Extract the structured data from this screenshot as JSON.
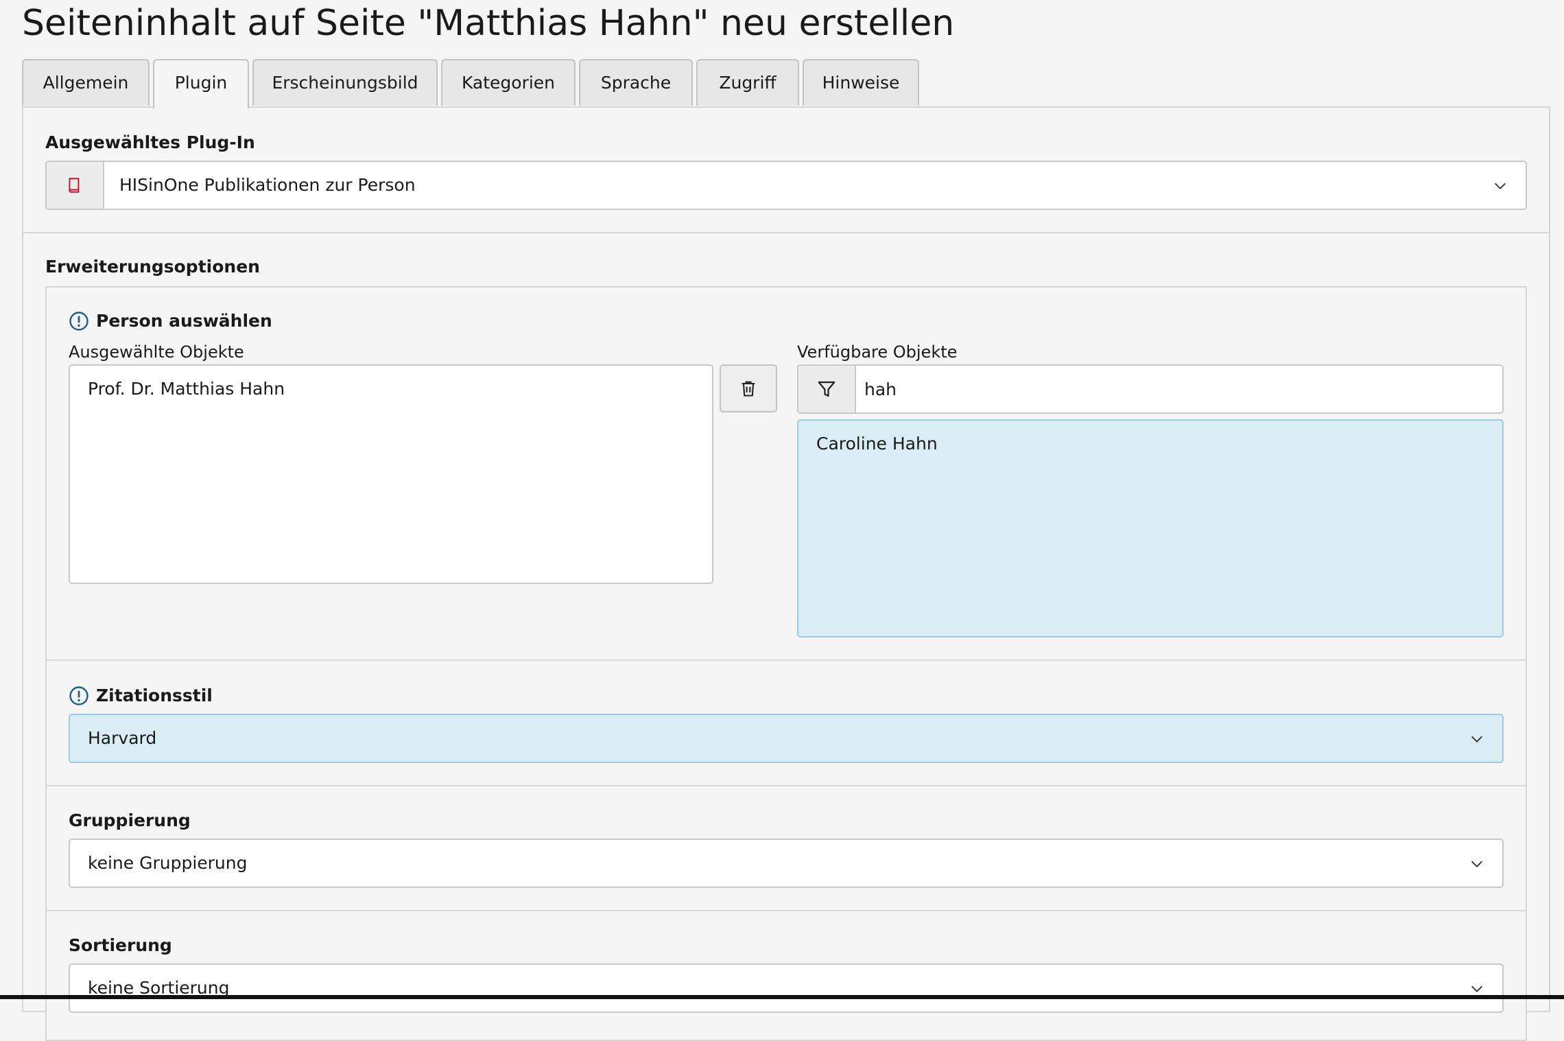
{
  "page": {
    "title": "Seiteninhalt auf Seite \"Matthias Hahn\" neu erstellen"
  },
  "tabs": [
    {
      "label": "Allgemein",
      "active": false
    },
    {
      "label": "Plugin",
      "active": true
    },
    {
      "label": "Erscheinungsbild",
      "active": false
    },
    {
      "label": "Kategorien",
      "active": false
    },
    {
      "label": "Sprache",
      "active": false
    },
    {
      "label": "Zugriff",
      "active": false
    },
    {
      "label": "Hinweise",
      "active": false
    }
  ],
  "plugin": {
    "label": "Ausgewähltes Plug-In",
    "value": "HISinOne Publikationen zur Person",
    "icon": "book-icon"
  },
  "extension": {
    "label": "Erweiterungsoptionen",
    "person": {
      "label": "Person auswählen",
      "selected_label": "Ausgewählte Objekte",
      "selected_items": [
        "Prof. Dr. Matthias Hahn"
      ],
      "available_label": "Verfügbare Objekte",
      "filter_value": "hah",
      "available_items": [
        "Caroline Hahn"
      ]
    },
    "citation": {
      "label": "Zitationsstil",
      "value": "Harvard"
    },
    "grouping": {
      "label": "Gruppierung",
      "value": "keine Gruppierung"
    },
    "sorting": {
      "label": "Sortierung",
      "value": "keine Sortierung"
    }
  },
  "colors": {
    "highlight": "#daecf4",
    "info": "#1f5f8b",
    "plugin_icon": "#c8102e"
  }
}
